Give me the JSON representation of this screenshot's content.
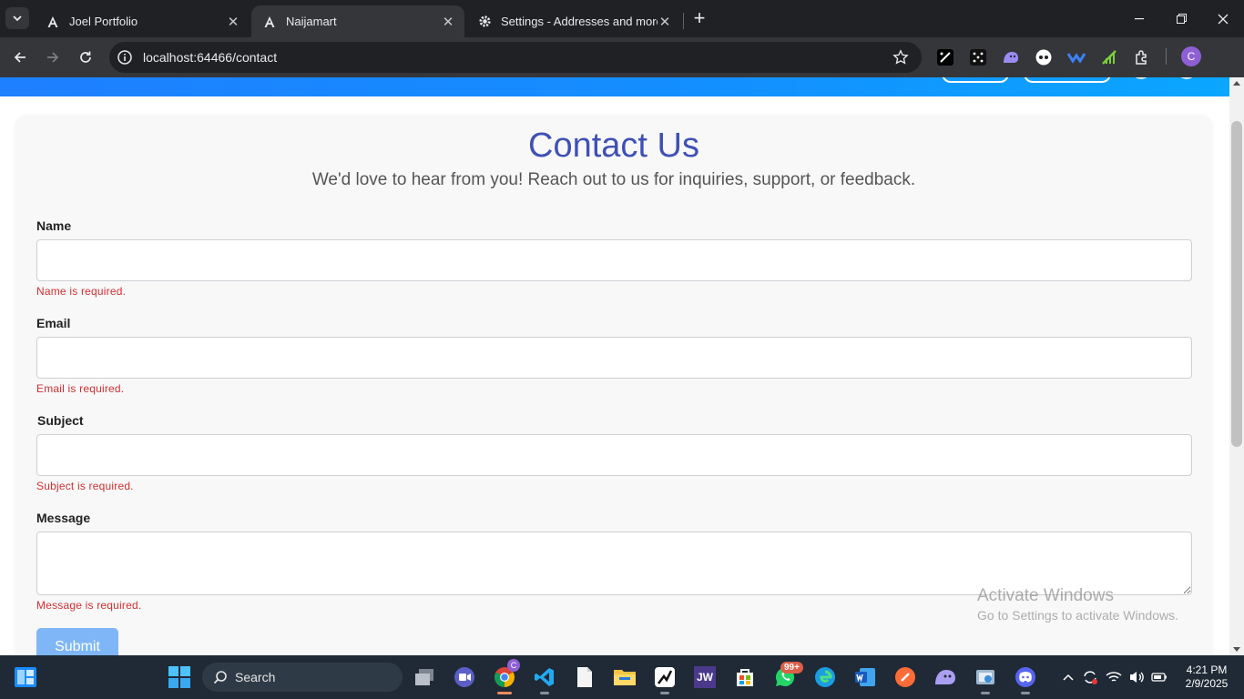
{
  "browser": {
    "tabs": [
      {
        "title": "Joel Portfolio",
        "icon": "angular-icon"
      },
      {
        "title": "Naijamart",
        "icon": "angular-icon",
        "active": true
      },
      {
        "title": "Settings - Addresses and more",
        "icon": "gear-icon"
      }
    ],
    "url": "localhost:64466/contact",
    "profile_initial": "C"
  },
  "page": {
    "title": "Contact Us",
    "subtitle": "We'd love to hear from you! Reach out to us for inquiries, support, or feedback.",
    "fields": {
      "name": {
        "label": "Name",
        "value": "",
        "error": "Name is required."
      },
      "email": {
        "label": "Email",
        "value": "",
        "error": "Email is required."
      },
      "subject": {
        "label": "Subject",
        "value": "",
        "error": "Subject is required."
      },
      "message": {
        "label": "Message",
        "value": "",
        "error": "Message is required."
      }
    },
    "submit_label": "Submit",
    "colors": {
      "title": "#3f51b5",
      "error": "#d32f2f",
      "header": "#1e7fff",
      "submit": "#7fb6f7"
    }
  },
  "watermark": {
    "line1": "Activate Windows",
    "line2": "Go to Settings to activate Windows."
  },
  "taskbar": {
    "search_label": "Search",
    "whatsapp_badge": "99+",
    "chrome_badge": "C",
    "jw_label": "JW",
    "time": "4:21 PM",
    "date": "2/9/2025"
  }
}
